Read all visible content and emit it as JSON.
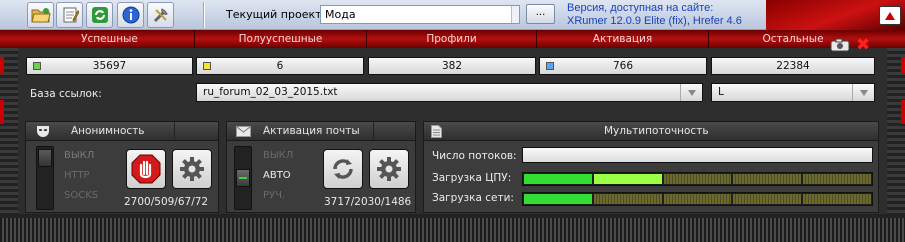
{
  "toolbar": {
    "buttons": [
      "folder-open-icon",
      "edit-document-icon",
      "refresh-icon",
      "info-icon",
      "tools-icon"
    ],
    "project_label": "Текущий проект:",
    "project_value": "Мода",
    "browse_label": "...",
    "version_line1": "Версия, доступная на сайте:",
    "version_line2": "XRumer 12.0.9 Elite (fix), Hrefer 4.6"
  },
  "stats": {
    "headers": [
      "Успешные",
      "Полууспешные",
      "Профили",
      "Активация",
      "Остальные"
    ],
    "values": [
      "35697",
      "6",
      "382",
      "766",
      "22384"
    ],
    "dot_colors": [
      "#6fd04a",
      "#f2e33a",
      null,
      "#5aa7f0",
      null
    ]
  },
  "links_db": {
    "label": "База ссылок:",
    "value": "ru_forum_02_03_2015.txt",
    "mode": "L"
  },
  "anonymity": {
    "title": "Анонимность",
    "options": [
      "ВЫКЛ",
      "HTTP",
      "SOCKS"
    ],
    "selected": "ВЫКЛ",
    "stats": "2700/509/67/72"
  },
  "mail_activation": {
    "title": "Активация почты",
    "options": [
      "ВЫКЛ",
      "АВТО",
      "РУЧ."
    ],
    "selected": "АВТО",
    "stats": "3717/2030/1486"
  },
  "multithreading": {
    "title": "Мультипоточность",
    "threads_label": "Число потоков:",
    "threads_value": "",
    "cpu_label": "Загрузка ЦПУ:",
    "cpu_load": 0.4,
    "net_label": "Загрузка сети:",
    "net_load": 0.2,
    "meter_colors": {
      "active": "#33dd33",
      "highlight": "#99ff44",
      "inactive": "#6b6a2e"
    }
  }
}
